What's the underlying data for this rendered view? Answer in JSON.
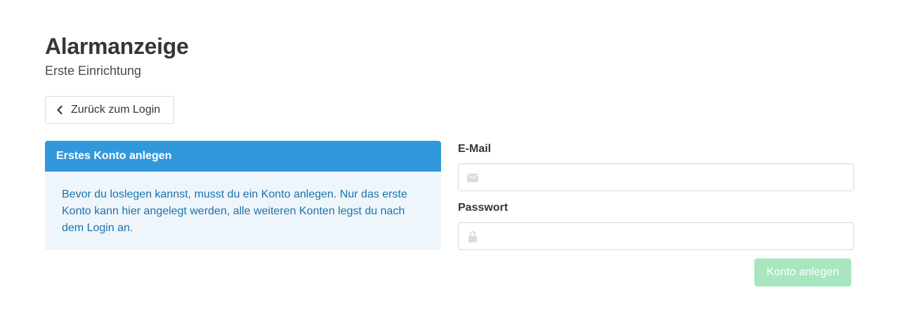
{
  "header": {
    "title": "Alarmanzeige",
    "subtitle": "Erste Einrichtung"
  },
  "back_button": {
    "label": "Zurück zum Login",
    "icon": "chevron-left-icon"
  },
  "info_message": {
    "header": "Erstes Konto anlegen",
    "body": "Bevor du loslegen kannst, musst du ein Konto anlegen. Nur das erste Konto kann hier angelegt werden, alle weiteren Konten legst du nach dem Login an."
  },
  "form": {
    "email": {
      "label": "E-Mail",
      "value": "",
      "placeholder": "",
      "icon": "envelope-icon"
    },
    "password": {
      "label": "Passwort",
      "value": "",
      "placeholder": "",
      "icon": "lock-icon"
    },
    "submit_label": "Konto anlegen",
    "submit_disabled": true
  },
  "colors": {
    "message_header": "#3298dc",
    "message_body_bg": "#eef6fc",
    "message_text": "#1d72aa",
    "submit_disabled_bg": "#a8e6c0",
    "icon_gray": "#dbdbdb"
  }
}
